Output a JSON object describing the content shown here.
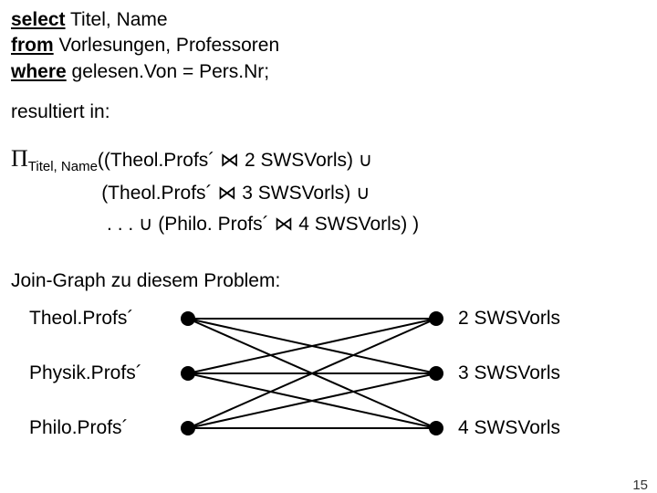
{
  "sql": {
    "kw_select": "select",
    "select_list": " Titel, Name",
    "kw_from": "from",
    "from_list": " Vorlesungen, Professoren",
    "kw_where": "where",
    "where_clause": " gelesen.Von = Pers.Nr;"
  },
  "result_label": "resultiert in:",
  "ra": {
    "pi_symbol": "Π",
    "pi_sub": "Titel, Name",
    "line1_rest": "((Theol.Profs´ ⋈ 2 SWSVorls) ∪",
    "line2": "(Theol.Profs´ ⋈ 3 SWSVorls) ∪",
    "line3": ". . . ∪ (Philo. Profs´ ⋈ 4 SWSVorls) )"
  },
  "graph_label": "Join-Graph zu diesem Problem:",
  "graph": {
    "left": [
      "Theol.Profs´",
      "Physik.Profs´",
      "Philo.Profs´"
    ],
    "right": [
      "2 SWSVorls",
      "3 SWSVorls",
      "4 SWSVorls"
    ]
  },
  "page_number": "15"
}
